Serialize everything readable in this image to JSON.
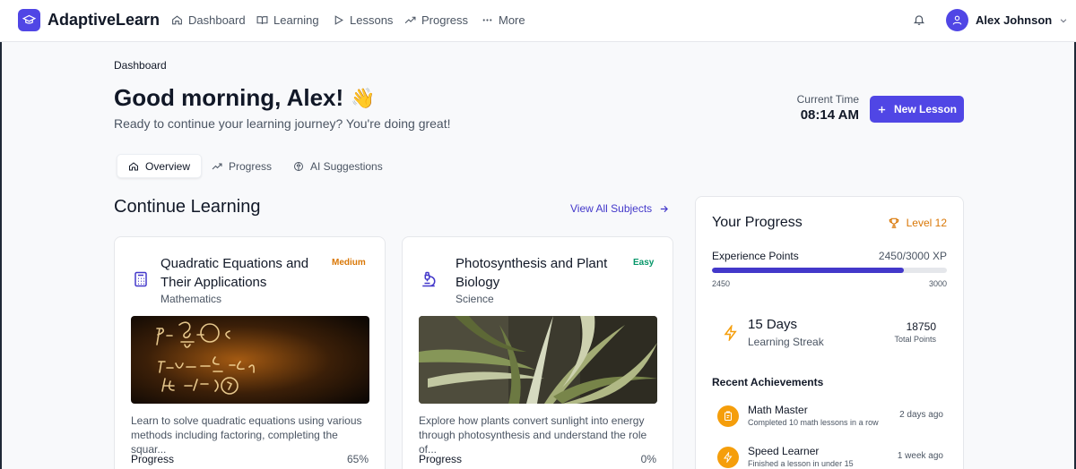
{
  "app": {
    "name": "AdaptiveLearn"
  },
  "nav": [
    {
      "label": "Dashboard",
      "icon": "home-icon"
    },
    {
      "label": "Learning",
      "icon": "book-icon"
    },
    {
      "label": "Lessons",
      "icon": "play-icon"
    },
    {
      "label": "Progress",
      "icon": "trending-up-icon"
    },
    {
      "label": "More",
      "icon": "more-icon"
    }
  ],
  "user": {
    "name": "Alex Johnson"
  },
  "header": {
    "breadcrumb": "Dashboard",
    "greeting": "Good morning, Alex!",
    "emoji": "👋",
    "subtitle": "Ready to continue your learning journey? You're doing great!",
    "time_label": "Current Time",
    "time_value": "08:14 AM",
    "new_lesson": "New Lesson"
  },
  "tabs": [
    {
      "label": "Overview",
      "active": true
    },
    {
      "label": "Progress",
      "active": false
    },
    {
      "label": "AI Suggestions",
      "active": false
    }
  ],
  "continue": {
    "title": "Continue Learning",
    "view_all": "View All Subjects",
    "cards": [
      {
        "title": "Quadratic Equations and Their Applications",
        "subject": "Mathematics",
        "difficulty": "Medium",
        "difficulty_color": "#d97706",
        "description": "Learn to solve quadratic equations using various methods including factoring, completing the squar...",
        "progress_label": "Progress",
        "progress": "65%"
      },
      {
        "title": "Photosynthesis and Plant Biology",
        "subject": "Science",
        "difficulty": "Easy",
        "difficulty_color": "#059669",
        "description": "Explore how plants convert sunlight into energy through photosynthesis and understand the role of...",
        "progress_label": "Progress",
        "progress": "0%"
      }
    ]
  },
  "progress_panel": {
    "title": "Your Progress",
    "level": "Level 12",
    "xp_label": "Experience Points",
    "xp_value": "2450/3000 XP",
    "xp_fraction": 0.8167,
    "xp_min": "2450",
    "xp_max": "3000",
    "streak_days": "15 Days",
    "streak_label": "Learning Streak",
    "total_points": "18750",
    "total_points_label": "Total Points",
    "achievements_title": "Recent Achievements",
    "achievements": [
      {
        "name": "Math Master",
        "desc": "Completed 10 math lessons in a row",
        "when": "2 days ago"
      },
      {
        "name": "Speed Learner",
        "desc": "Finished a lesson in under 15",
        "when": "1 week ago"
      }
    ]
  },
  "colors": {
    "primary": "#5046e5",
    "accent": "#f59e0b"
  }
}
